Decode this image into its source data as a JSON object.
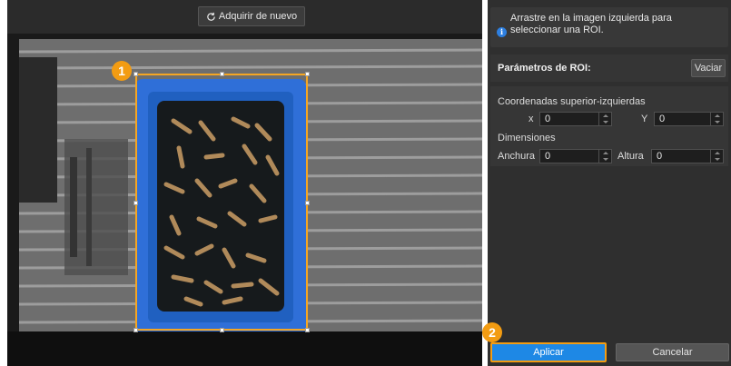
{
  "toolbar": {
    "reacquire_label": "Adquirir de nuevo",
    "reacquire_icon": "refresh-icon"
  },
  "callouts": {
    "one": "1",
    "two": "2"
  },
  "info": {
    "text": "Arrastre en la imagen izquierda para seleccionar una ROI.",
    "icon": "info-icon"
  },
  "roi_params": {
    "title": "Parámetros de ROI:",
    "clear_label": "Vaciar",
    "top_left_label": "Coordenadas superior-izquierdas",
    "x_label": "x",
    "x_value": "0",
    "y_label": "Y",
    "y_value": "0",
    "dimensions_label": "Dimensiones",
    "width_label": "Anchura",
    "width_value": "0",
    "height_label": "Altura",
    "height_value": "0"
  },
  "actions": {
    "apply_label": "Aplicar",
    "cancel_label": "Cancelar"
  },
  "colors": {
    "roi_border": "#f5a623",
    "callout": "#f39c12",
    "apply_bg": "#1e88e5",
    "bin_blue": "#2f6fd8"
  }
}
